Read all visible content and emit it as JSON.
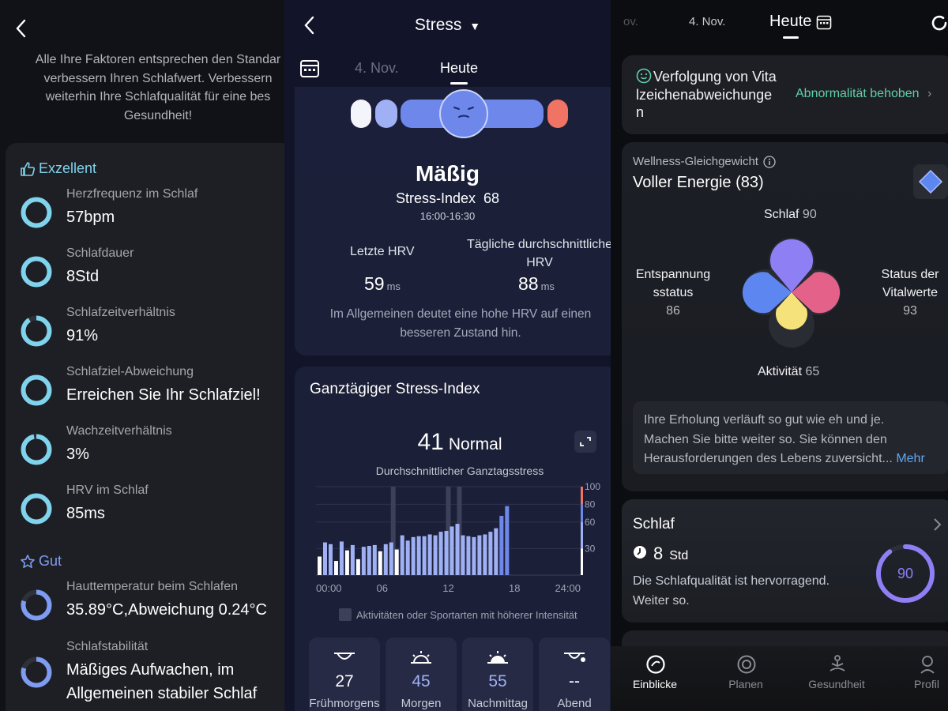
{
  "panel1": {
    "intro_lines": [
      "Alle Ihre Faktoren entsprechen den Standar",
      "verbessern Ihren Schlafwert. Verbessern",
      "weiterhin Ihre Schlafqualität für eine bes",
      "Gesundheit!"
    ],
    "section_excellent": "Exzellent",
    "section_good": "Gut",
    "items": [
      {
        "label": "Herzfrequenz im Schlaf",
        "value": "57bpm",
        "fraction": 1.0
      },
      {
        "label": "Schlafdauer",
        "value": "8Std",
        "fraction": 1.0
      },
      {
        "label": "Schlafzeitverhältnis",
        "value": "91%",
        "fraction": 0.91
      },
      {
        "label": "Schlafziel-Abweichung",
        "value": "Erreichen Sie Ihr Schlafziel!",
        "fraction": 1.0
      },
      {
        "label": "Wachzeitverhältnis",
        "value": "3%",
        "fraction": 0.97
      },
      {
        "label": "HRV im Schlaf",
        "value": "85ms",
        "fraction": 1.0
      },
      {
        "label": "Hauttemperatur beim Schlafen",
        "value": "35.89°C,Abweichung 0.24°C",
        "fraction": 0.8
      },
      {
        "label": "Schlafstabilität",
        "value_line1": "Mäßiges Aufwachen, im",
        "value_line2": "Allgemeinen stabiler Schlaf",
        "fraction": 0.8
      }
    ],
    "colors": {
      "excellent": "#7fd3ec",
      "good": "#7d9cf2"
    }
  },
  "panel2": {
    "title": "Stress",
    "tabs": [
      "4. Nov.",
      "Heute"
    ],
    "mood": "Mäßig",
    "stress_index_label": "Stress-Index",
    "stress_index_value": "68",
    "time_range": "16:00-16:30",
    "hrv_last_label": "Letzte HRV",
    "hrv_avg_label_l1": "Tägliche durchschnittliche",
    "hrv_avg_label_l2": "HRV",
    "hrv_last_value": "59",
    "hrv_avg_value": "88",
    "hrv_unit": "ms",
    "note_l1": "Im Allgemeinen deutet eine hohe HRV auf einen",
    "note_l2": "besseren Zustand hin.",
    "day_card_title": "Ganztägiger Stress-Index",
    "day_score": "41",
    "day_score_text": "Normal",
    "day_avg_label": "Durchschnittlicher Ganztagsstress",
    "legend": "Aktivitäten oder Sportarten mit höherer Intensität",
    "tiles": [
      {
        "value": "27",
        "label": "Frühmorgens",
        "icon": "moon-horizon-icon"
      },
      {
        "value": "45",
        "label": "Morgen",
        "icon": "sunrise-icon"
      },
      {
        "value": "55",
        "label": "Nachmittag",
        "icon": "sun-icon"
      },
      {
        "value": "--",
        "label": "Abend",
        "icon": "moon-set-icon"
      }
    ],
    "colors": {
      "relaxed": "#ffffff",
      "normal": "#9fb1f4",
      "medium": "#6d87ea",
      "high": "#f07464"
    }
  },
  "chart_data": {
    "type": "bar",
    "x_ticks": [
      "00:00",
      "06",
      "12",
      "18",
      "24:00"
    ],
    "y_ticks": [
      100,
      80,
      60,
      30
    ],
    "ylim": [
      0,
      100
    ],
    "xlim_hours": [
      0,
      24
    ],
    "values": [
      21,
      37,
      35,
      16,
      38,
      28,
      34,
      18,
      32,
      33,
      34,
      27,
      35,
      37,
      29,
      45,
      39,
      43,
      44,
      44,
      46,
      45,
      49,
      50,
      55,
      58,
      45,
      44,
      43,
      45,
      46,
      49,
      53,
      67,
      78
    ],
    "bar_start_hour": 0.0,
    "bar_step_hours": 0.5,
    "high_activity_hours": [
      7.0,
      12.0,
      13.0
    ],
    "legend": [
      "Aktivitäten oder Sportarten mit höherer Intensität"
    ]
  },
  "panel3": {
    "tab_prev": "ov.",
    "tab_date": "4. Nov.",
    "tab_today": "Heute",
    "vita_title_l1": "Verfolgung von Vita",
    "vita_title_l2": "lzeichenabweichunge",
    "vita_title_l3": "n",
    "vita_action": "Abnormalität behoben",
    "wellness_label": "Wellness-Gleichgewicht",
    "wellness_title": "Voller Energie (83)",
    "sleep_label": "Schlaf",
    "sleep_value": "90",
    "relax_l1": "Entspannung",
    "relax_l2": "sstatus",
    "relax_value": "86",
    "vital_l1": "Status der",
    "vital_l2": "Vitalwerte",
    "vital_value": "93",
    "activity_label": "Aktivität",
    "activity_value": "65",
    "msg_l1": "Ihre Erholung verläuft so gut wie eh und je.",
    "msg_l2": "Machen Sie bitte weiter so. Sie können den",
    "msg_l3": "Herausforderungen des Lebens zuversicht...",
    "msg_more": "Mehr",
    "sleep_card_title": "Schlaf",
    "sleep_hours": "8",
    "sleep_unit": "Std",
    "sleep_msg_l1": "Die Schlafqualität ist hervorragend.",
    "sleep_msg_l2": "Weiter so.",
    "sleep_score": "90",
    "sleep_score_fraction": 0.9,
    "nav": [
      "Einblicke",
      "Planen",
      "Gesundheit",
      "Profil"
    ],
    "colors": {
      "sleep": "#8f7ff5",
      "relax": "#5e86f0",
      "vital": "#e4628a",
      "activity": "#f5e27a",
      "accent": "#5fd0a6"
    }
  }
}
